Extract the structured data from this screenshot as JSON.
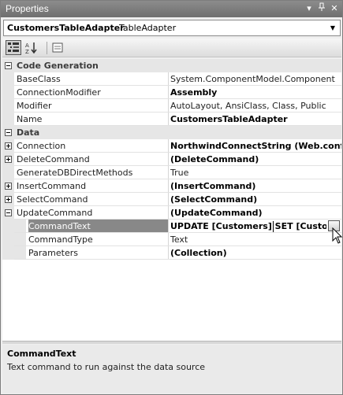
{
  "window": {
    "title": "Properties",
    "pin_icon": "pin-icon",
    "close_icon": "close-icon",
    "dropdown_icon": "menu-dropdown-icon"
  },
  "object_selector": {
    "name": "CustomersTableAdapter",
    "type": "TableAdapter"
  },
  "toolbar": {
    "buttons": [
      "categorized-icon",
      "alphabetical-icon",
      "property-pages-icon"
    ]
  },
  "grid": {
    "rows": [
      {
        "kind": "category",
        "label": "Code Generation",
        "expanded": true
      },
      {
        "kind": "prop",
        "label": "BaseClass",
        "value": "System.ComponentModel.Component",
        "bold": false
      },
      {
        "kind": "prop",
        "label": "ConnectionModifier",
        "value": "Assembly",
        "bold": true
      },
      {
        "kind": "prop",
        "label": "Modifier",
        "value": "AutoLayout, AnsiClass, Class, Public",
        "bold": false
      },
      {
        "kind": "prop",
        "label": "Name",
        "value": "CustomersTableAdapter",
        "bold": true
      },
      {
        "kind": "category",
        "label": "Data",
        "expanded": true
      },
      {
        "kind": "prop",
        "label": "Connection",
        "value": "NorthwindConnectString (Web.config)",
        "bold": true,
        "expander": "plus"
      },
      {
        "kind": "prop",
        "label": "DeleteCommand",
        "value": "(DeleteCommand)",
        "bold": true,
        "expander": "plus"
      },
      {
        "kind": "prop",
        "label": "GenerateDBDirectMethods",
        "value": "True",
        "bold": false
      },
      {
        "kind": "prop",
        "label": "InsertCommand",
        "value": "(InsertCommand)",
        "bold": true,
        "expander": "plus"
      },
      {
        "kind": "prop",
        "label": "SelectCommand",
        "value": "(SelectCommand)",
        "bold": true,
        "expander": "plus"
      },
      {
        "kind": "prop",
        "label": "UpdateCommand",
        "value": "(UpdateCommand)",
        "bold": true,
        "expander": "minus"
      },
      {
        "kind": "child",
        "label": "CommandText",
        "value": "UPDATE [Customers] SET [Customers",
        "bold": true,
        "selected": true
      },
      {
        "kind": "child",
        "label": "CommandType",
        "value": "Text",
        "bold": false
      },
      {
        "kind": "child",
        "label": "Parameters",
        "value": "(Collection)",
        "bold": true
      }
    ]
  },
  "description": {
    "title": "CommandText",
    "text": "Text command to run against the data source"
  },
  "colors": {
    "titlebar": "#7a7a7a",
    "selection": "#888888",
    "category": "#e6e6e6"
  }
}
